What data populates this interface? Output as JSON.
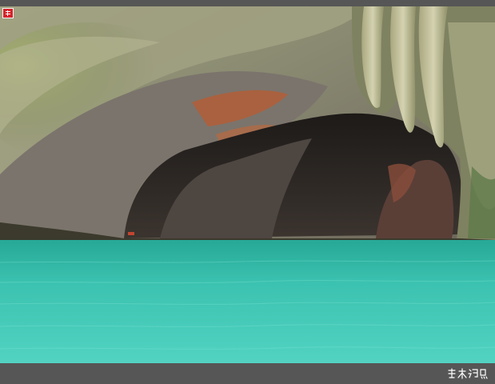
{
  "photo": {
    "subject": "",
    "watermark_text": "瑞木鸿鸟",
    "seal_text": "瑞",
    "colors": {
      "frame": "#565656",
      "water_light": "#4fd0c0",
      "water_dark": "#1fa593",
      "rock_moss": "#8b9a62",
      "rock_gray": "#8a8478",
      "rock_rust": "#b85a30",
      "cave_shadow": "#2a2522",
      "stalactite": "#c9c7a4"
    }
  }
}
